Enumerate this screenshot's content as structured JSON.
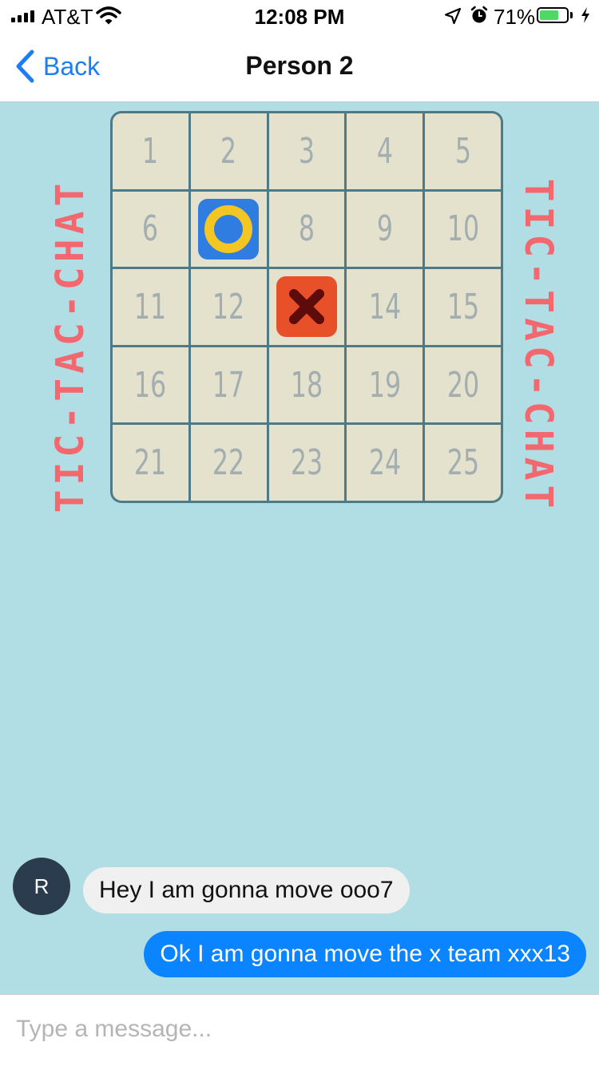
{
  "status_bar": {
    "carrier": "AT&T",
    "time": "12:08 PM",
    "battery_percent": "71%",
    "battery_level": 0.71,
    "battery_color": "#4cd964"
  },
  "nav": {
    "back_label": "Back",
    "title": "Person 2",
    "accent": "#1a7ef5"
  },
  "game": {
    "side_title": "TIC-TAC-CHAT",
    "board_bg": "#b1dee5",
    "cells": [
      "1",
      "2",
      "3",
      "4",
      "5",
      "6",
      "7",
      "8",
      "9",
      "10",
      "11",
      "12",
      "13",
      "14",
      "15",
      "16",
      "17",
      "18",
      "19",
      "20",
      "21",
      "22",
      "23",
      "24",
      "25"
    ],
    "pieces": [
      {
        "cell": 7,
        "type": "o",
        "icon": "o-piece-icon"
      },
      {
        "cell": 13,
        "type": "x",
        "icon": "x-piece-icon"
      }
    ]
  },
  "messages": [
    {
      "sender": "R",
      "direction": "incoming",
      "text": "Hey I am gonna move ooo7"
    },
    {
      "direction": "outgoing",
      "text": "Ok I am gonna move the x team xxx13"
    }
  ],
  "composer": {
    "placeholder": "Type a message..."
  }
}
